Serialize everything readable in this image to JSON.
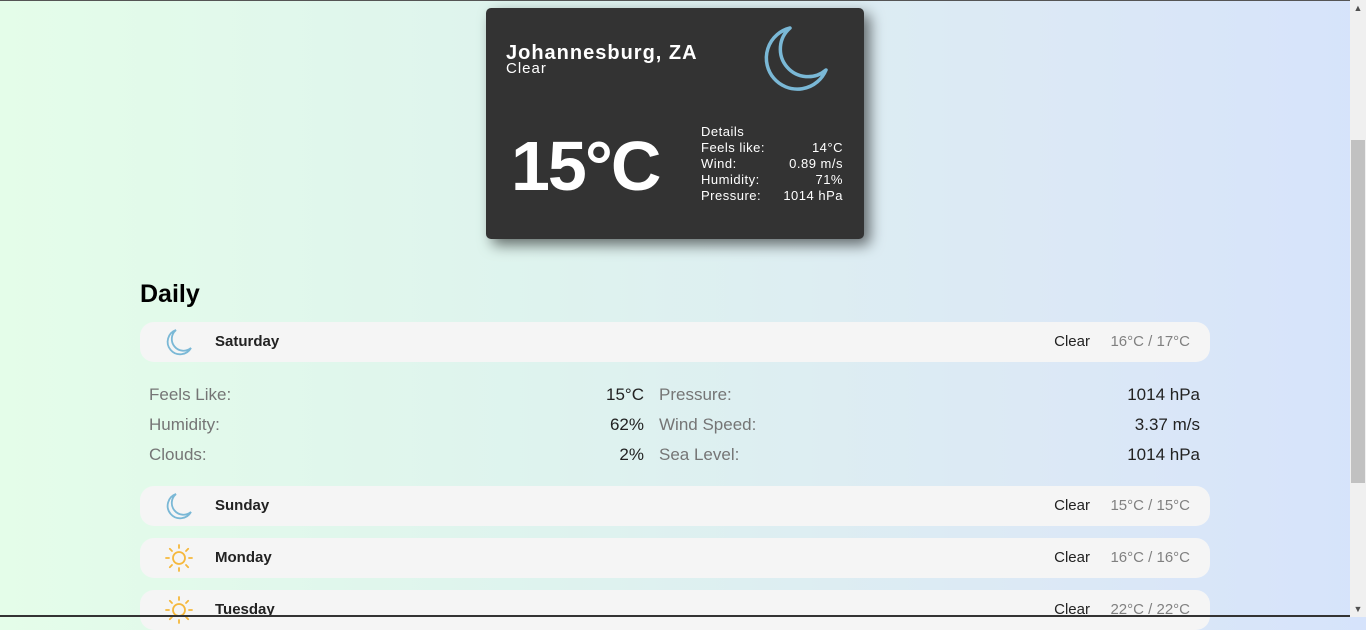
{
  "current": {
    "city": "Johannesburg, ZA",
    "description": "Clear",
    "icon": "moon-icon",
    "temperature": "15°C",
    "details_heading": "Details",
    "details": [
      {
        "label": "Feels like:",
        "value": "14°C"
      },
      {
        "label": "Wind:",
        "value": "0.89 m/s"
      },
      {
        "label": "Humidity:",
        "value": "71%"
      },
      {
        "label": "Pressure:",
        "value": "1014 hPa"
      }
    ]
  },
  "daily": {
    "title": "Daily",
    "days": [
      {
        "name": "Saturday",
        "icon": "moon-icon",
        "description": "Clear",
        "temp": "16°C / 17°C"
      },
      {
        "name": "Sunday",
        "icon": "moon-icon",
        "description": "Clear",
        "temp": "15°C / 15°C"
      },
      {
        "name": "Monday",
        "icon": "sun-icon",
        "description": "Clear",
        "temp": "16°C / 16°C"
      },
      {
        "name": "Tuesday",
        "icon": "sun-icon",
        "description": "Clear",
        "temp": "22°C / 22°C"
      }
    ],
    "expanded": {
      "left": [
        {
          "label": "Feels Like:",
          "value": "15°C"
        },
        {
          "label": "Humidity:",
          "value": "62%"
        },
        {
          "label": "Clouds:",
          "value": "2%"
        }
      ],
      "right": [
        {
          "label": "Pressure:",
          "value": "1014 hPa"
        },
        {
          "label": "Wind Speed:",
          "value": "3.37 m/s"
        },
        {
          "label": "Sea Level:",
          "value": "1014 hPa"
        }
      ]
    }
  },
  "colors": {
    "card_bg": "#333333",
    "moon": "#7ab8d6",
    "sun": "#f5b83c",
    "row_bg": "#f5f5f5"
  }
}
